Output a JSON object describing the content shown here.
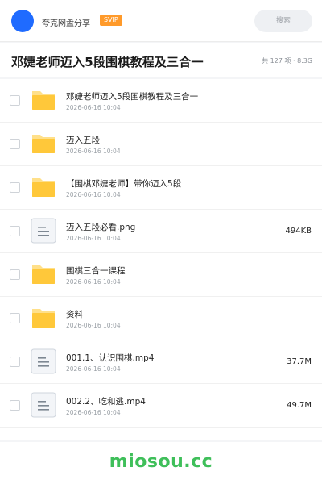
{
  "header": {
    "app_name": "夸克网盘分享",
    "badge": "SVIP",
    "search_placeholder": "搜索",
    "avatar_color": "#1f6bff",
    "badge_color": "#ff9a2a"
  },
  "folder": {
    "title": "邓婕老师迈入5段围棋教程及三合一",
    "summary": "共 127 项 · 8.3G"
  },
  "files": [
    {
      "icon": "folder-icon",
      "name": "邓婕老师迈入5段围棋教程及三合一",
      "date": "2026-06-16 10:04",
      "size": ""
    },
    {
      "icon": "folder-icon",
      "name": "迈入五段",
      "date": "2026-06-16 10:04",
      "size": ""
    },
    {
      "icon": "folder-icon",
      "name": "【围棋邓婕老师】带你迈入5段",
      "date": "2026-06-16 10:04",
      "size": ""
    },
    {
      "icon": "file-icon",
      "name": "迈入五段必看.png",
      "date": "2026-06-16 10:04",
      "size": "494KB"
    },
    {
      "icon": "folder-icon",
      "name": "围棋三合一课程",
      "date": "2026-06-16 10:04",
      "size": ""
    },
    {
      "icon": "folder-icon",
      "name": "资料",
      "date": "2026-06-16 10:04",
      "size": ""
    },
    {
      "icon": "file-icon",
      "name": "001.1、认识围棋.mp4",
      "date": "2026-06-16 10:04",
      "size": "37.7M"
    },
    {
      "icon": "file-icon",
      "name": "002.2、吃和逃.mp4",
      "date": "2026-06-16 10:04",
      "size": "49.7M"
    }
  ],
  "watermark": "miosou.cc",
  "colors": {
    "folder": "#ffc83a",
    "folder_tab": "#ffe08a",
    "watermark": "#3fbf5a"
  }
}
